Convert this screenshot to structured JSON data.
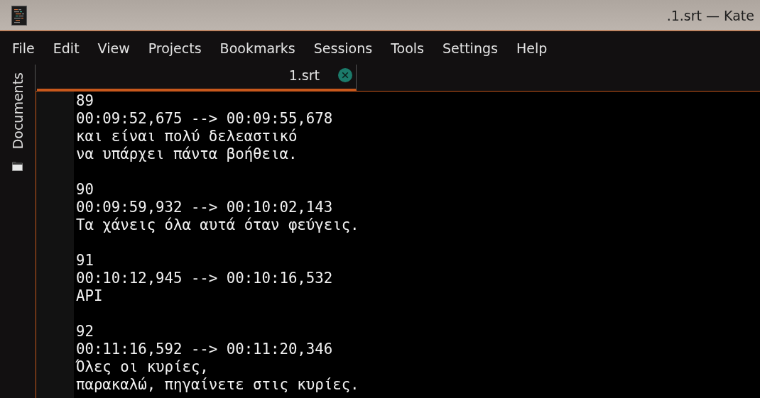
{
  "window": {
    "title": ".1.srt — Kate"
  },
  "menu": [
    "File",
    "Edit",
    "View",
    "Projects",
    "Bookmarks",
    "Sessions",
    "Tools",
    "Settings",
    "Help"
  ],
  "sidebar": {
    "items": [
      {
        "label": "Documents",
        "selected": false
      }
    ]
  },
  "tabs": [
    {
      "label": "1.srt",
      "selected": true
    }
  ],
  "editor": {
    "entries": [
      {
        "index": "89",
        "timing": "00:09:52,675 --> 00:09:55,678",
        "text": [
          "και είναι πολύ δελεαστικό",
          "να υπάρχει πάντα βοήθεια."
        ]
      },
      {
        "index": "90",
        "timing": "00:09:59,932 --> 00:10:02,143",
        "text": [
          "Τα χάνεις όλα αυτά όταν φεύγεις."
        ]
      },
      {
        "index": "91",
        "timing": "00:10:12,945 --> 00:10:16,532",
        "text": [
          "API"
        ]
      },
      {
        "index": "92",
        "timing": "00:11:16,592 --> 00:11:20,346",
        "text": [
          "Όλες οι κυρίες,",
          "παρακαλώ, πηγαίνετε στις κυρίες."
        ]
      }
    ]
  }
}
